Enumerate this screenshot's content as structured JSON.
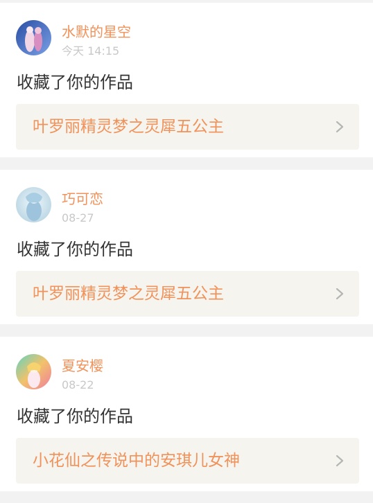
{
  "notifications": [
    {
      "username": "水默的星空",
      "time": "今天 14:15",
      "action": "收藏了你的作品",
      "work_title": "叶罗丽精灵梦之灵犀五公主",
      "avatar": {
        "bg": "#3a5fae",
        "accent": "#e48ab8"
      }
    },
    {
      "username": "巧可恋",
      "time": "08-27",
      "action": "收藏了你的作品",
      "work_title": "叶罗丽精灵梦之灵犀五公主",
      "avatar": {
        "bg": "#cfe3ec",
        "accent": "#8fb8d6"
      }
    },
    {
      "username": "夏安樱",
      "time": "08-22",
      "action": "收藏了你的作品",
      "work_title": "小花仙之传说中的安琪儿女神",
      "avatar": {
        "bg": "#6fd6b8",
        "accent": "#f07a9a"
      }
    }
  ]
}
